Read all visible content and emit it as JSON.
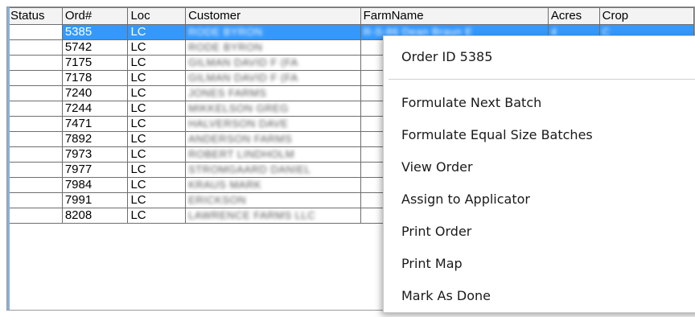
{
  "columns": [
    "Status",
    "Ord#",
    "Loc",
    "Customer",
    "FarmName",
    "Acres",
    "Crop"
  ],
  "rows": [
    {
      "ord": "5385",
      "loc": "LC",
      "customer": "RODE BYRON",
      "farm": "R-S-86 Dean Braun E",
      "acres": "4",
      "crop": "C"
    },
    {
      "ord": "5742",
      "loc": "LC",
      "customer": "RODE BYRON"
    },
    {
      "ord": "7175",
      "loc": "LC",
      "customer": "GILMAN DAVID F (FA"
    },
    {
      "ord": "7178",
      "loc": "LC",
      "customer": "GILMAN DAVID F (FA"
    },
    {
      "ord": "7240",
      "loc": "LC",
      "customer": "JONES FARMS"
    },
    {
      "ord": "7244",
      "loc": "LC",
      "customer": "MIKKELSON GREG"
    },
    {
      "ord": "7471",
      "loc": "LC",
      "customer": "HALVERSON DAVE"
    },
    {
      "ord": "7892",
      "loc": "LC",
      "customer": "ANDERSON FARMS"
    },
    {
      "ord": "7973",
      "loc": "LC",
      "customer": "ROBERT LINDHOLM"
    },
    {
      "ord": "7977",
      "loc": "LC",
      "customer": "STROMGAARD DANIEL"
    },
    {
      "ord": "7984",
      "loc": "LC",
      "customer": "KRAUS MARK"
    },
    {
      "ord": "7991",
      "loc": "LC",
      "customer": "ERICKSON"
    },
    {
      "ord": "8208",
      "loc": "LC",
      "customer": "LAWRENCE FARMS LLC"
    }
  ],
  "context_menu": {
    "header": "Order ID 5385",
    "items": [
      "Formulate Next Batch",
      "Formulate Equal Size Batches",
      "View Order",
      "Assign to Applicator",
      "Print Order",
      "Print Map",
      "Mark As Done"
    ]
  },
  "colors": {
    "selection": "#3399ff",
    "header_bg": "#f3f3f3",
    "grid_line": "#6e6e6e"
  }
}
